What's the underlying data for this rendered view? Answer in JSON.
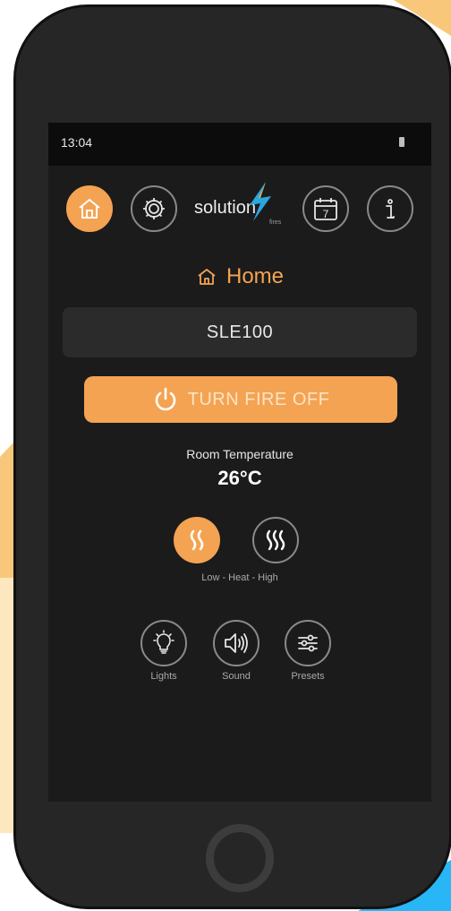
{
  "colors": {
    "accent": "#f4a352",
    "background": "#1b1b1b",
    "status_bar": "#0c0c0c",
    "panel": "#2b2b2b",
    "phone_body": "#262626"
  },
  "status_bar": {
    "time": "13:04",
    "battery_icon": "battery-icon"
  },
  "nav": {
    "items": [
      {
        "id": "home",
        "icon": "home-icon",
        "active": true
      },
      {
        "id": "settings",
        "icon": "gear-icon",
        "active": false
      },
      {
        "id": "schedule",
        "icon": "calendar-icon",
        "calendar_day": "7",
        "active": false
      },
      {
        "id": "info",
        "icon": "info-icon",
        "active": false
      }
    ],
    "logo": {
      "word": "solution",
      "sub": "fires"
    }
  },
  "page": {
    "title": "Home",
    "title_icon": "home-outline-icon"
  },
  "device": {
    "name": "SLE100"
  },
  "fire_button": {
    "label": "TURN FIRE OFF",
    "icon": "power-icon"
  },
  "temperature": {
    "label": "Room Temperature",
    "value": "26°C"
  },
  "heat": {
    "caption": "Low - Heat - High",
    "low_icon": "heat-low-icon",
    "high_icon": "heat-high-icon",
    "selected": "low"
  },
  "tools": {
    "lights": {
      "label": "Lights",
      "icon": "bulb-icon"
    },
    "sound": {
      "label": "Sound",
      "icon": "speaker-icon"
    },
    "presets": {
      "label": "Presets",
      "icon": "sliders-icon"
    }
  }
}
